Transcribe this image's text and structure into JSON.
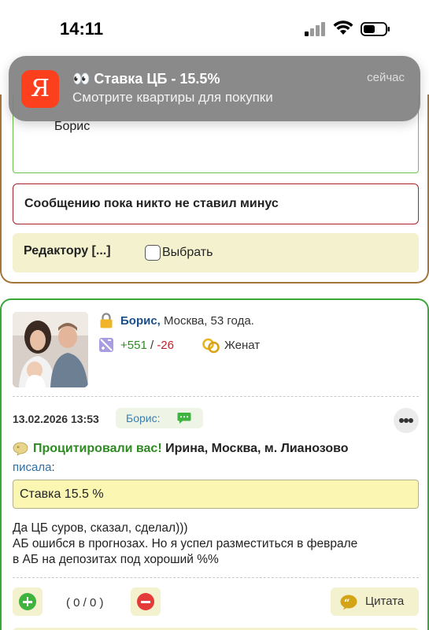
{
  "status_bar": {
    "time": "14:11"
  },
  "notification": {
    "app_icon_letter": "Я",
    "title": "👀 Ставка ЦБ - 15.5%",
    "body": "Смотрите квартиры для покупки",
    "time": "сейчас"
  },
  "previous_post": {
    "quote_author": "Борис",
    "minus_status": "Сообщению пока никто не ставил минус",
    "editor_label": "Редактору [...]",
    "select_label": "Выбрать"
  },
  "post": {
    "author_name": "Борис,",
    "author_details": " Москва, 53 года.",
    "rating_plus": "+551",
    "rating_sep": " / ",
    "rating_minus": "-26",
    "marital_status": "Женат",
    "date": "13.02.2026 13:53",
    "to_label": "Борис:",
    "cited_prefix": "Процитировали вас!",
    "cited_author": " Ирина, Москва, м. Лианозово",
    "wrote_link": "писала",
    "wrote_suffix": ":",
    "quote_text": "Ставка 15.5 %",
    "message_lines": [
      "Да ЦБ суров, сказал, сделал)))",
      "АБ ошибся в прогнозах. Но я успел разместиться в феврале",
      "в АБ на депозитах под хороший %%"
    ],
    "votes": "( 0 / 0 )",
    "cite_button": "Цитата"
  },
  "colors": {
    "accent_green": "#3aa73a",
    "accent_brown": "#a5763a",
    "minus_red": "#c0232b",
    "yandex_red": "#fc3f1d",
    "cream": "#f4f1cf"
  }
}
